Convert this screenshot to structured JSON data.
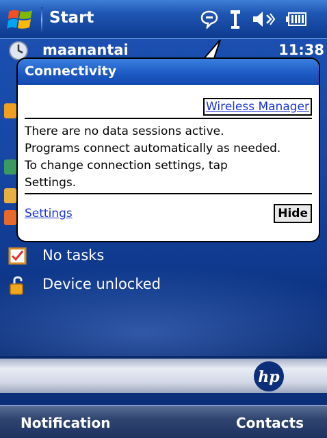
{
  "titlebar": {
    "start_label": "Start",
    "icons": [
      "start-flag-icon",
      "notification-bubble-icon",
      "connectivity-icon",
      "volume-icon",
      "battery-icon"
    ]
  },
  "today": {
    "owner": "maanantai",
    "time": "11:38",
    "tasks": "No tasks",
    "lock": "Device unlocked"
  },
  "balloon": {
    "title": "Connectivity",
    "wireless_manager": "Wireless Manager",
    "lines": [
      "There are no data sessions active.",
      "Programs connect automatically as needed.",
      "To change connection settings, tap",
      "Settings."
    ],
    "settings_link": "Settings",
    "hide_label": "Hide"
  },
  "softkeys": {
    "left": "Notification",
    "right": "Contacts"
  },
  "colors": {
    "titlebar": "#1f56b4",
    "balloon_header": "#1c58c2",
    "link": "#1a34d6",
    "softbar": "#2f4470"
  }
}
